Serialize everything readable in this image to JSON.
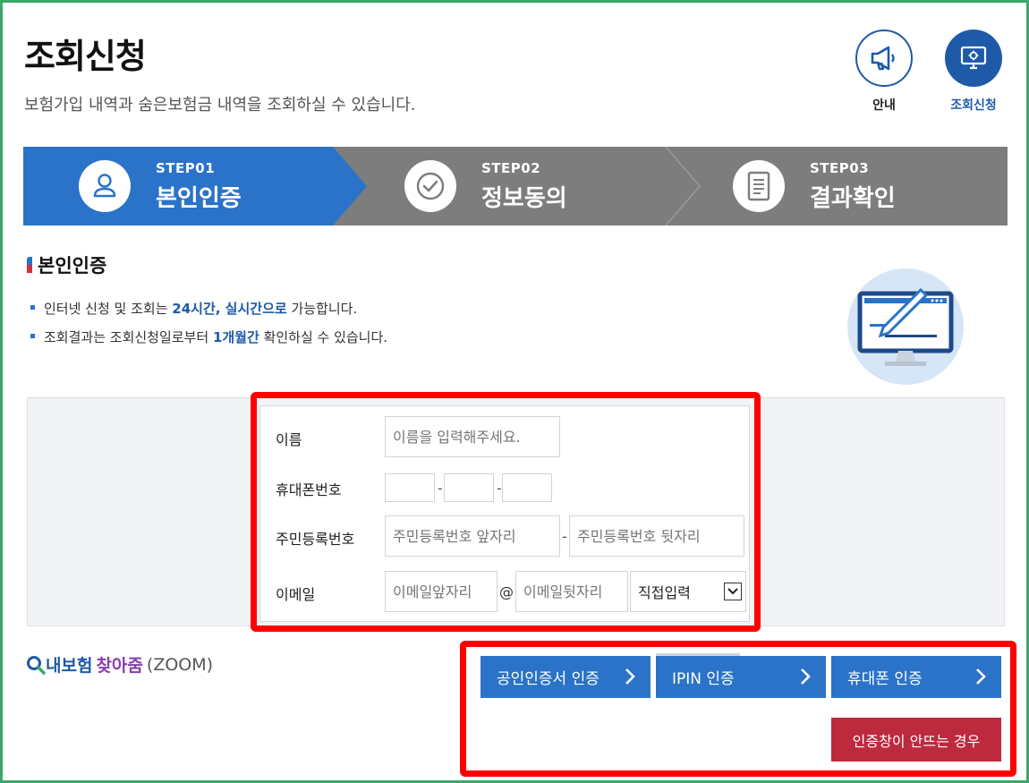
{
  "header": {
    "title": "조회신청",
    "subtitle": "보험가입 내역과 숨은보험금 내역을 조회하실 수 있습니다."
  },
  "quick_menu": [
    {
      "label": "안내",
      "icon": "megaphone-icon"
    },
    {
      "label": "조회신청",
      "icon": "monitor-gear-icon"
    }
  ],
  "steps": [
    {
      "no": "STEP01",
      "name": "본인인증",
      "icon": "user-icon",
      "active": true
    },
    {
      "no": "STEP02",
      "name": "정보동의",
      "icon": "check-circle-icon",
      "active": false
    },
    {
      "no": "STEP03",
      "name": "결과확인",
      "icon": "document-icon",
      "active": false
    }
  ],
  "section": {
    "title": "본인인증",
    "notes": [
      {
        "pre": "인터넷 신청 및 조회는 ",
        "hl": "24시간, 실시간으로",
        "post": " 가능합니다."
      },
      {
        "pre": "조회결과는 조회신청일로부터 ",
        "hl": "1개월간",
        "post": " 확인하실 수 있습니다."
      }
    ]
  },
  "form": {
    "name_label": "이름",
    "name_placeholder": "이름을 입력해주세요.",
    "phone_label": "휴대폰번호",
    "phone_sep": "-",
    "rrn_label": "주민등록번호",
    "rrn_front_placeholder": "주민등록번호 앞자리",
    "rrn_back_placeholder": "주민등록번호 뒷자리",
    "rrn_sep": "-",
    "email_label": "이메일",
    "email_local_placeholder": "이메일앞자리",
    "email_at": "@",
    "email_domain_placeholder": "이메일뒷자리",
    "email_select_value": "직접입력"
  },
  "zoom_logo": {
    "part1": "내보험",
    "part2": "찾아줌",
    "part3": "(ZOOM)"
  },
  "auth_buttons": [
    {
      "label": "공인인증서 인증"
    },
    {
      "label": "IPIN 인증"
    },
    {
      "label": "휴대폰 인증"
    }
  ],
  "popup_help": "인증창이 안뜨는 경우",
  "colors": {
    "primary": "#2a73c9",
    "step_inactive": "#7d7d7d",
    "help_button": "#bd2a3e",
    "highlight_box": "#ff0000"
  }
}
